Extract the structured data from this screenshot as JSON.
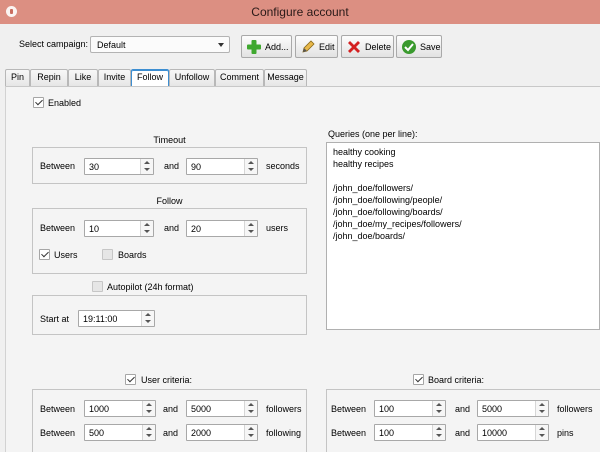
{
  "window": {
    "title": "Configure account"
  },
  "toolbar": {
    "campaign_label": "Select campaign:",
    "campaign_value": "Default",
    "add_label": "Add...",
    "edit_label": "Edit",
    "delete_label": "Delete",
    "save_label": "Save"
  },
  "tabs": [
    "Pin",
    "Repin",
    "Like",
    "Invite",
    "Follow",
    "Unfollow",
    "Comment",
    "Message"
  ],
  "enabled_label": "Enabled",
  "timeout": {
    "title": "Timeout",
    "between": "Between",
    "and": "and",
    "min": "30",
    "max": "90",
    "unit": "seconds"
  },
  "follow": {
    "title": "Follow",
    "between": "Between",
    "and": "and",
    "min": "10",
    "max": "20",
    "unit": "users",
    "users_label": "Users",
    "boards_label": "Boards"
  },
  "autopilot": {
    "label": "Autopilot (24h format)",
    "start_label": "Start at",
    "start_value": "19:11:00"
  },
  "queries": {
    "label": "Queries (one per line):",
    "lines": [
      "healthy cooking",
      "healthy recipes",
      "",
      "/john_doe/followers/",
      "/john_doe/following/people/",
      "/john_doe/following/boards/",
      "/john_doe/my_recipes/followers/",
      "/john_doe/boards/"
    ]
  },
  "user_criteria": {
    "label": "User criteria:",
    "between": "Between",
    "and": "and",
    "row1_min": "1000",
    "row1_max": "5000",
    "row1_unit": "followers",
    "row2_min": "500",
    "row2_max": "2000",
    "row2_unit": "following"
  },
  "board_criteria": {
    "label": "Board criteria:",
    "between": "Between",
    "and": "and",
    "row1_min": "100",
    "row1_max": "5000",
    "row1_unit": "followers",
    "row2_min": "100",
    "row2_max": "10000",
    "row2_unit": "pins"
  },
  "colors": {
    "titlebar": "#dc8f82",
    "tab_active_border": "#3d8ed1",
    "add_icon": "#3fa82f",
    "delete_icon": "#d42020",
    "save_icon": "#3a9a2e"
  }
}
